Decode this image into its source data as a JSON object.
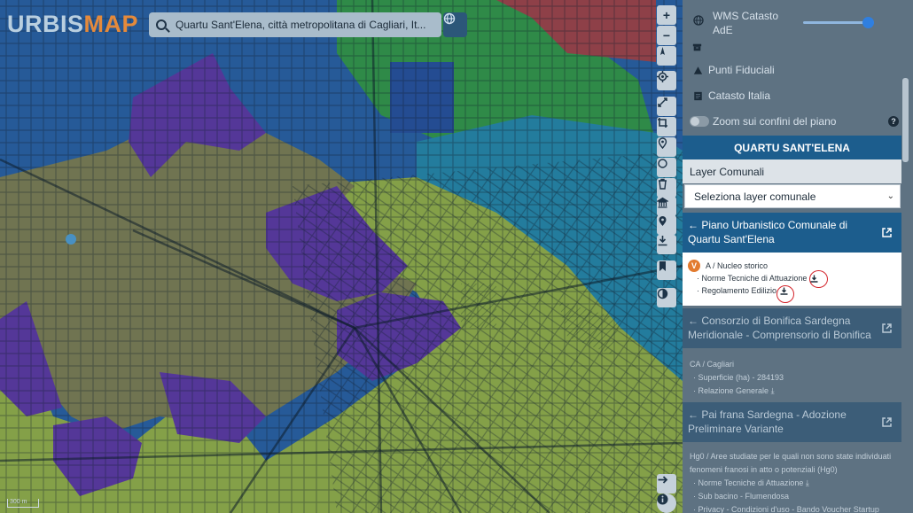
{
  "logo": {
    "part1": "URBIS",
    "part2": "MAP"
  },
  "search": {
    "value": "Quartu Sant'Elena, città metropolitana di Cagliari, It..."
  },
  "map": {
    "scale_label": "300 m"
  },
  "toolbar": {
    "zoom_in": "+",
    "zoom_out": "−"
  },
  "sidebar": {
    "wms_label": "WMS Catasto AdE",
    "punti_label": "Punti Fiduciali",
    "catasto_label": "Catasto Italia",
    "zoom_label": "Zoom sui confini del piano",
    "help": "?",
    "panel_title": "QUARTU SANT'ELENA",
    "layer_label": "Layer Comunali",
    "layer_select": "Seleziona layer comunale",
    "plans": [
      {
        "title": "← Piano Urbanistico Comunale di Quartu Sant'Elena",
        "badge": "V",
        "zone": "A / Nucleo storico",
        "docs": [
          "· Norme Tecniche di Attuazione",
          "· Regolamento Edilizio"
        ]
      },
      {
        "title": "← Consorzio di Bonifica Sardegna Meridionale - Comprensorio di Bonifica",
        "zone": "CA / Cagliari",
        "docs": [
          "· Superficie (ha) - 284193",
          "· Relazione Generale"
        ]
      },
      {
        "title": "← Pai frana Sardegna - Adozione Preliminare Variante",
        "zone": "Hg0 / Aree studiate per le quali non sono state individuati fenomeni franosi in atto o potenziali (Hg0)",
        "docs": [
          "· Norme Tecniche di Attuazione",
          "· Sub bacino - Flumendosa",
          "· Privacy - Condizioni d'uso - Bando Voucher Startup"
        ]
      }
    ]
  },
  "colors": {
    "accent": "#1c5d8d",
    "logo_orange": "#e58a3b",
    "badge_orange": "#e27b2f",
    "highlight_red": "#d3232a",
    "zone_blue": "#2f68b0",
    "zone_purple": "#6a3cb0",
    "zone_olive": "#8e8a55",
    "zone_green": "#3aa64a",
    "zone_yellowgreen": "#a7c24a",
    "zone_teal": "#2b94b7"
  }
}
